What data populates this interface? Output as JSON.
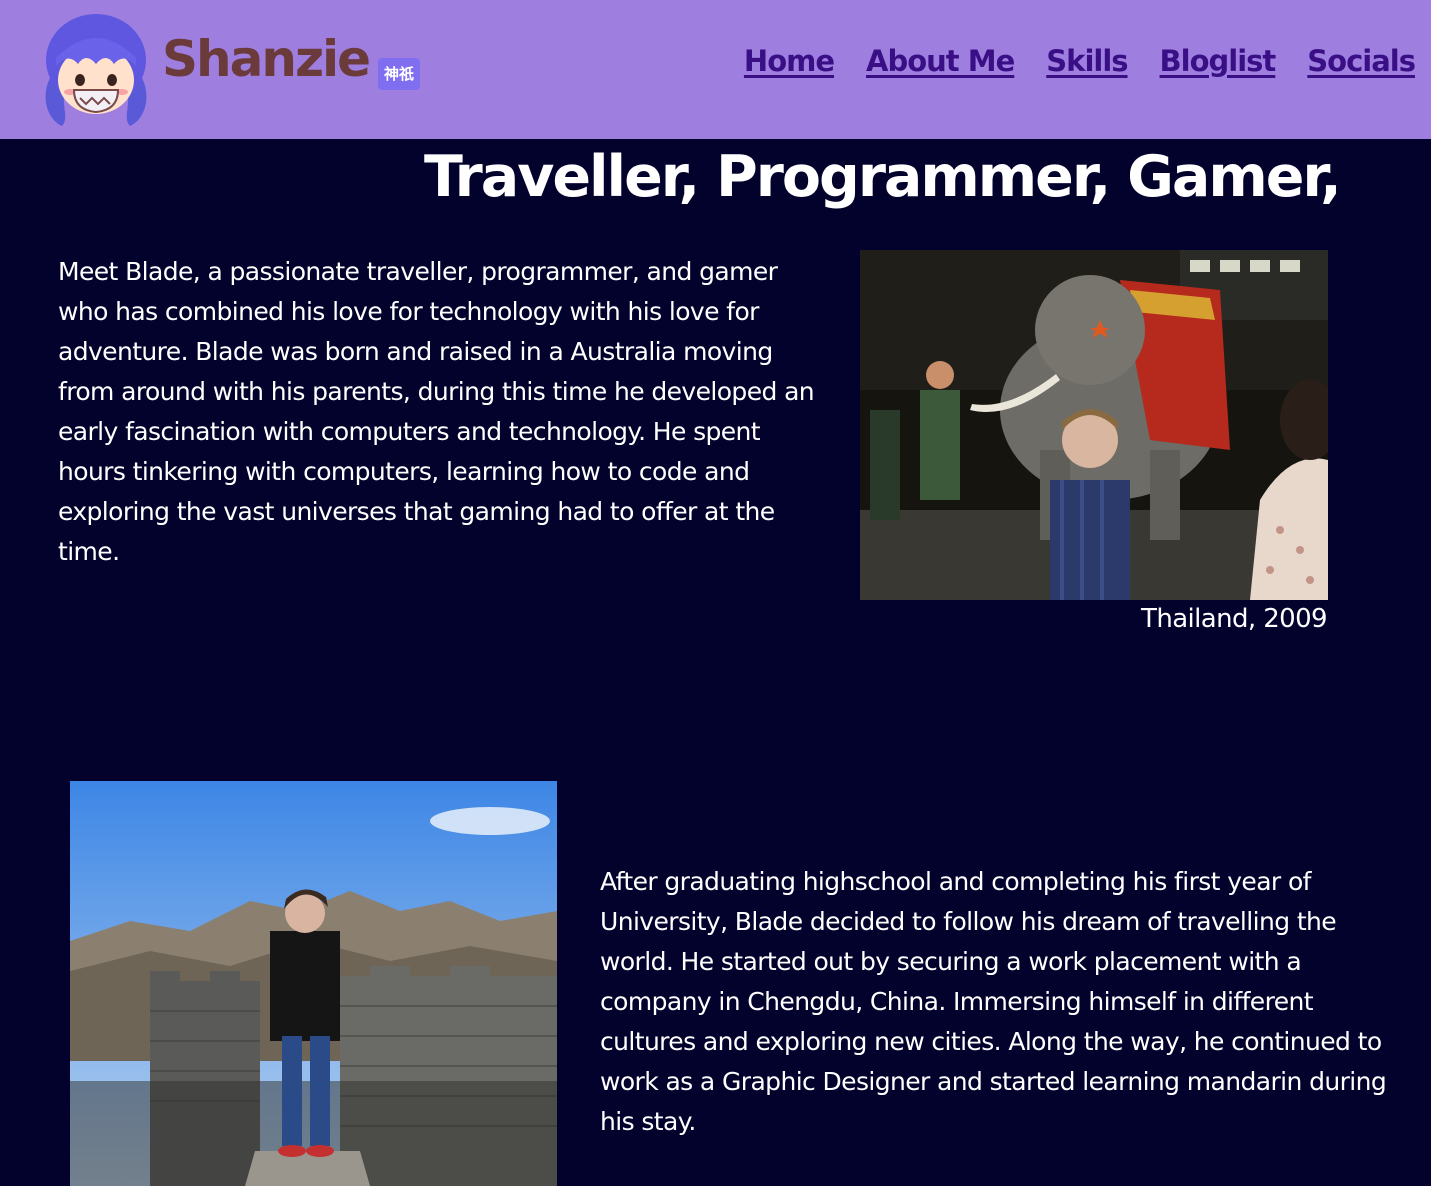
{
  "header": {
    "brand": "Shanzie",
    "badge": "神祇",
    "nav": [
      "Home",
      "About Me",
      "Skills",
      "Bloglist",
      "Socials"
    ]
  },
  "headline": "Traveller, Programmer, Gamer,",
  "section1": {
    "text": "Meet Blade, a passionate traveller, programmer, and gamer who has combined his love for technology with his love for adventure. Blade was born and raised in a Australia moving from around with his parents, during this time he developed an early fascination with computers and technology. He spent hours tinkering with computers, learning how to code and exploring the vast universes that gaming had to offer at the time.",
    "caption": "Thailand, 2009"
  },
  "section2": {
    "text": "After graduating highschool and completing his first year of University, Blade decided to follow his dream of travelling the world. He started out by securing a work placement with a company in Chengdu, China. Immersing himself in different cultures and exploring new cities. Along the way, he continued to work as a Graphic Designer and started learning mandarin during his stay."
  },
  "colors": {
    "background": "#02022d",
    "header": "#9e7fe0",
    "nav_link": "#3a0f86",
    "brand": "#6b3a3a",
    "badge": "#7f6ff0"
  }
}
